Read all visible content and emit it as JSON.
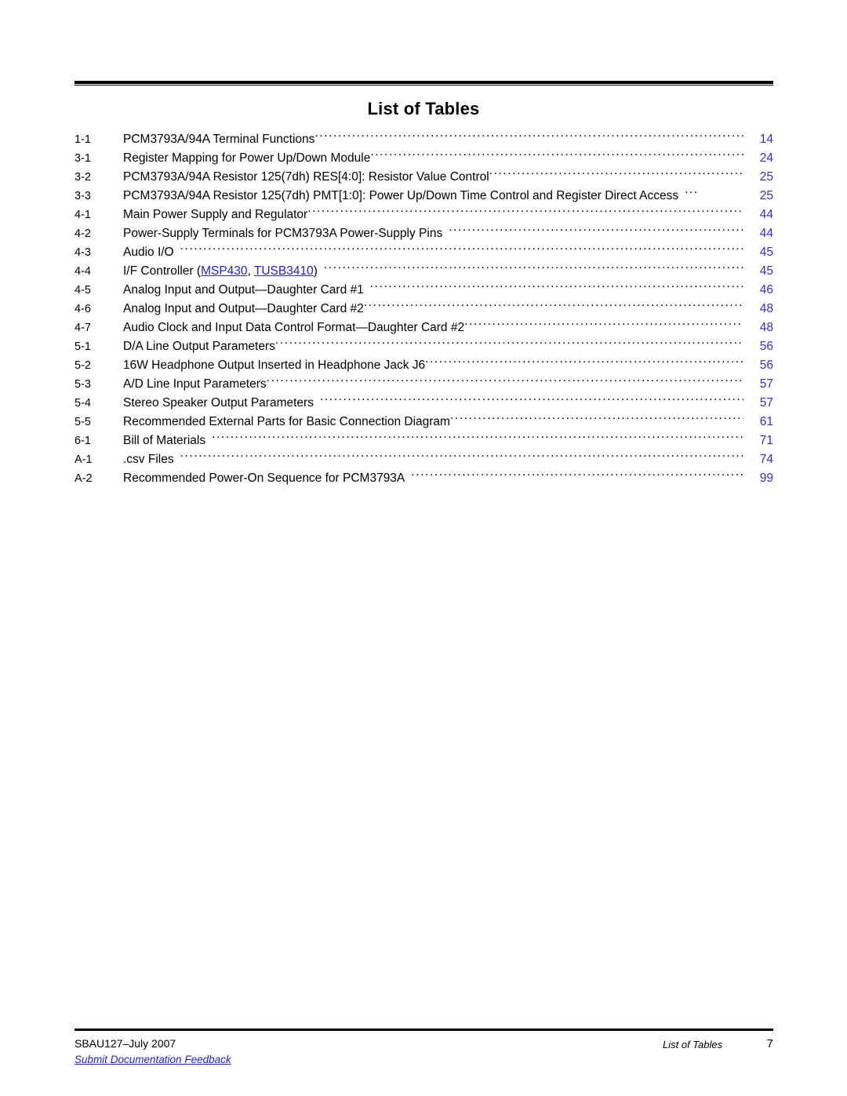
{
  "document": {
    "title": "List of Tables"
  },
  "toc": {
    "entries": [
      {
        "number": "1-1",
        "title": "PCM3793A/94A Terminal Functions",
        "page": "14",
        "lead": "normal"
      },
      {
        "number": "3-1",
        "title": "Register Mapping for Power Up/Down Module",
        "page": "24",
        "lead": "normal"
      },
      {
        "number": "3-2",
        "title": "PCM3793A/94A Resistor 125(7dh) RES[4:0]: Resistor Value Control",
        "page": "25",
        "lead": "normal"
      },
      {
        "number": "3-3",
        "title": "PCM3793A/94A Resistor 125(7dh) PMT[1:0]: Power Up/Down Time Control and Register Direct Access",
        "page": "25",
        "lead": "short"
      },
      {
        "number": "4-1",
        "title": "Main Power Supply and Regulator",
        "page": "44",
        "lead": "normal"
      },
      {
        "number": "4-2",
        "title": "Power-Supply Terminals for PCM3793A Power-Supply Pins",
        "page": "44",
        "lead": "gap"
      },
      {
        "number": "4-3",
        "title": "Audio I/O",
        "page": "45",
        "lead": "gap"
      },
      {
        "number": "4-4",
        "title": "I/F Controller (MSP430, TUSB3410)",
        "page": "45",
        "lead": "gap",
        "links": [
          "MSP430",
          "TUSB3410"
        ]
      },
      {
        "number": "4-5",
        "title": "Analog Input and Output—Daughter Card #1",
        "page": "46",
        "lead": "gap"
      },
      {
        "number": "4-6",
        "title": "Analog Input and Output—Daughter Card #2",
        "page": "48",
        "lead": "normal"
      },
      {
        "number": "4-7",
        "title": "Audio Clock and Input Data Control Format—Daughter Card #2",
        "page": "48",
        "lead": "normal"
      },
      {
        "number": "5-1",
        "title": "D/A Line Output Parameters",
        "page": "56",
        "lead": "normal"
      },
      {
        "number": "5-2",
        "title": "16W Headphone Output Inserted in Headphone Jack J6",
        "page": "56",
        "lead": "normal"
      },
      {
        "number": "5-3",
        "title": "A/D Line Input Parameters",
        "page": "57",
        "lead": "normal"
      },
      {
        "number": "5-4",
        "title": "Stereo Speaker Output Parameters",
        "page": "57",
        "lead": "gap"
      },
      {
        "number": "5-5",
        "title": "Recommended External Parts for Basic Connection Diagram",
        "page": "61",
        "lead": "normal"
      },
      {
        "number": "6-1",
        "title": "Bill of Materials",
        "page": "71",
        "lead": "gap"
      },
      {
        "number": "A-1",
        "title": ".csv Files",
        "page": "74",
        "lead": "gap"
      },
      {
        "number": "A-2",
        "title": "Recommended Power-On Sequence for PCM3793A",
        "page": "99",
        "lead": "gap"
      }
    ]
  },
  "footer": {
    "document_id": "SBAU127–July 2007",
    "feedback_link": "Submit Documentation Feedback",
    "section_title": "List of Tables",
    "page_number": "7"
  },
  "colors": {
    "page_number": "#2f2fd0",
    "link": "#2020cf",
    "rule": "#000000"
  }
}
